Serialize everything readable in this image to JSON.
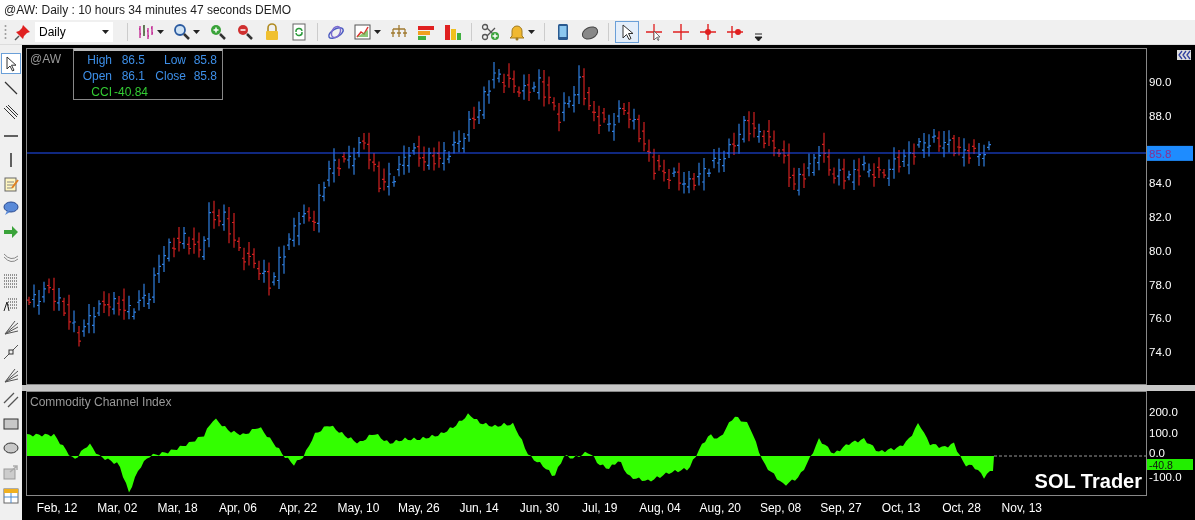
{
  "window": {
    "title": "@AW: Daily : 10 hours 34 minutes 47 seconds DEMO"
  },
  "toolbar": {
    "timeframe": "Daily",
    "tools": [
      {
        "kind": "bars",
        "menu": true,
        "selected": false
      },
      {
        "kind": "search",
        "menu": true,
        "selected": false
      },
      {
        "kind": "zoomin",
        "menu": false,
        "selected": false
      },
      {
        "kind": "zoomout",
        "menu": false,
        "selected": false
      },
      {
        "kind": "lock",
        "menu": false,
        "selected": false
      },
      {
        "kind": "refresh",
        "menu": false,
        "selected": false
      },
      {
        "kind": "orbit",
        "menu": false,
        "selected": false
      },
      {
        "kind": "chart",
        "menu": true,
        "selected": false
      },
      {
        "kind": "tree",
        "menu": false,
        "selected": false
      },
      {
        "kind": "heat",
        "menu": false,
        "selected": false
      },
      {
        "kind": "columns",
        "menu": false,
        "selected": false
      },
      {
        "kind": "scissors",
        "menu": false,
        "selected": false
      },
      {
        "kind": "bell",
        "menu": true,
        "selected": false
      },
      {
        "kind": "phone",
        "menu": false,
        "selected": false
      },
      {
        "kind": "mouse",
        "menu": false,
        "selected": false
      },
      {
        "kind": "pointer",
        "menu": false,
        "selected": true
      },
      {
        "kind": "crosshair",
        "menu": false,
        "selected": false
      },
      {
        "kind": "cross",
        "menu": false,
        "selected": false
      },
      {
        "kind": "dotcross",
        "menu": false,
        "selected": false
      },
      {
        "kind": "halfcross",
        "menu": false,
        "selected": false
      }
    ]
  },
  "drawing_tools": [
    {
      "kind": "pointer",
      "selected": true
    },
    {
      "kind": "line",
      "selected": false
    },
    {
      "kind": "channel",
      "selected": false
    },
    {
      "kind": "hline",
      "selected": false
    },
    {
      "kind": "vline",
      "selected": false
    },
    {
      "kind": "note",
      "selected": false
    },
    {
      "kind": "bubble",
      "selected": false
    },
    {
      "kind": "arrow",
      "selected": false
    },
    {
      "kind": "arc",
      "selected": false
    },
    {
      "kind": "grid",
      "selected": false
    },
    {
      "kind": "fib",
      "selected": false
    },
    {
      "kind": "fan",
      "selected": false
    },
    {
      "kind": "box",
      "selected": false
    },
    {
      "kind": "fan",
      "selected": false
    },
    {
      "kind": "parallel",
      "selected": false
    },
    {
      "kind": "rect",
      "selected": false
    },
    {
      "kind": "ellipse",
      "selected": false
    },
    {
      "kind": "export",
      "selected": false
    },
    {
      "kind": "table",
      "selected": false
    }
  ],
  "price_pane": {
    "symbol": "@AW",
    "info": {
      "high_label": "High",
      "high": "86.5",
      "low_label": "Low",
      "low": "85.8",
      "open_label": "Open",
      "open": "86.1",
      "close_label": "Close",
      "close": "85.8",
      "cci_label": "CCI",
      "cci": "-40.84"
    },
    "axis_labels": [
      "90.0",
      "88.0",
      "84.0",
      "82.0",
      "80.0",
      "78.0",
      "76.0",
      "74.0"
    ],
    "last_price": "85.8"
  },
  "cci_pane": {
    "title": "Commodity Channel Index",
    "axis_labels": [
      "200.0",
      "100.0",
      "0.0",
      "-100.0"
    ],
    "last_value": "-40.8",
    "brand": "SOL Trader"
  },
  "time_axis": [
    "Feb, 12",
    "Mar, 02",
    "Mar, 18",
    "Apr, 06",
    "Apr, 22",
    "May, 10",
    "May, 26",
    "Jun, 14",
    "Jun, 30",
    "Jul, 19",
    "Aug, 04",
    "Aug, 20",
    "Sep, 08",
    "Sep, 27",
    "Oct, 13",
    "Oct, 28",
    "Nov, 13"
  ]
}
